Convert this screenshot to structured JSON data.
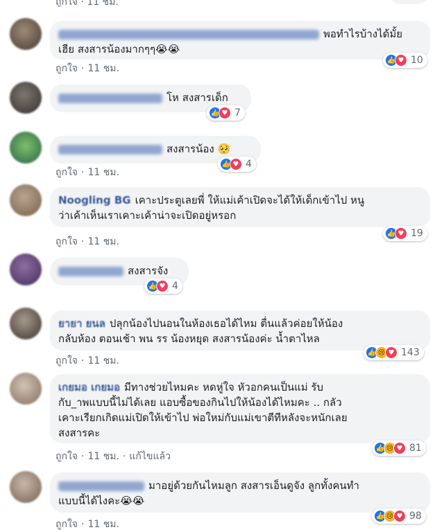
{
  "header_cut": {
    "like_label": "ถูกใจ",
    "time": "11 ชม."
  },
  "comments": [
    {
      "text_line1": "พอทำไรบ้างได้มั้ย",
      "text_line2": "เฮีย สงสารน้องมากๆๆ😭😭",
      "like_label": "ถูกใจ",
      "time": "11 ชม.",
      "reaction_count": "10",
      "reactions": [
        "like-icon",
        "love-icon"
      ]
    },
    {
      "text": "โห สงสารเด็ก",
      "reaction_count": "7",
      "reactions": [
        "like-icon",
        "love-icon"
      ]
    },
    {
      "text": "สงสารน้อง 🥺",
      "name_tail": "ai",
      "like_label": "ถูกใจ",
      "time": "11 ชม.",
      "reaction_count": "4",
      "reactions": [
        "like-icon",
        "love-icon"
      ]
    },
    {
      "name": "Noogling BG",
      "text_line1": "เคาะประตูเลยพี่ ให้แม่เค้าเปิดจะได้ให้เด็กเข้าไป หนู",
      "text_line2": "ว่าเค้าเห็นเราเคาะเค้าน่าจะเปิดอยู่หรอก",
      "like_label": "ถูกใจ",
      "time": "11 ชม.",
      "reaction_count": "19",
      "reactions": [
        "like-icon",
        "love-icon"
      ]
    },
    {
      "text": "สงสารจัง",
      "reaction_count": "4",
      "reactions": [
        "like-icon",
        "love-icon"
      ]
    },
    {
      "name": "ยายา ยนล",
      "text_line1": "ปลุกน้องไปนอนในห้องเธอได้ไหม ตื่นแล้วค่อยให้น้อง",
      "text_line2": "กลับห้อง ตอนเช้า พน รร น้องหยุด สงสารน้องค่ะ น้ำตาไหล",
      "like_label": "ถูกใจ",
      "time": "11 ชม.",
      "reaction_count": "143",
      "reactions": [
        "like-icon",
        "sad-icon",
        "love-icon"
      ]
    },
    {
      "name": "เกยมอ เกยมอ",
      "text_line1": "มีทางช่วยไหมคะ หดหู่ใจ หัวอกคนเป็นแม่ รับ",
      "text_line2": "กับ_าพแบบนี้ไม่ได้เลย แอบซื้อของกินไปให้น้องได้ไหมคะ .. กลัว",
      "text_line3": "เคาะเรียกเกิดแม่เปิดให้เข้าไป พ่อใหม่กับแม่เขาตีทีหลังจะหนักเลย",
      "text_line4": "สงสารคะ",
      "like_label": "ถูกใจ",
      "time": "11 ชม.",
      "edited": "แก้ไขแล้ว",
      "reaction_count": "81",
      "reactions": [
        "like-icon",
        "sad-icon",
        "love-icon"
      ]
    },
    {
      "text_line1": "มาอยู่ด้วยกันไหมลูก สงสารเอ็นดูจัง ลูกทั้งคนทำ",
      "text_line2": "แบบนี้ได้ไงคะ😭😭",
      "like_label": "ถูกใจ",
      "time": "11 ชม.",
      "reaction_count": "98",
      "reactions": [
        "like-icon",
        "sad-icon",
        "love-icon"
      ]
    }
  ],
  "colors": {
    "bubble": "#f2f3f5",
    "like": "#1877f2",
    "love": "#f33e58",
    "sad": "#f7b125",
    "meta": "#606770",
    "name": "#385898"
  }
}
